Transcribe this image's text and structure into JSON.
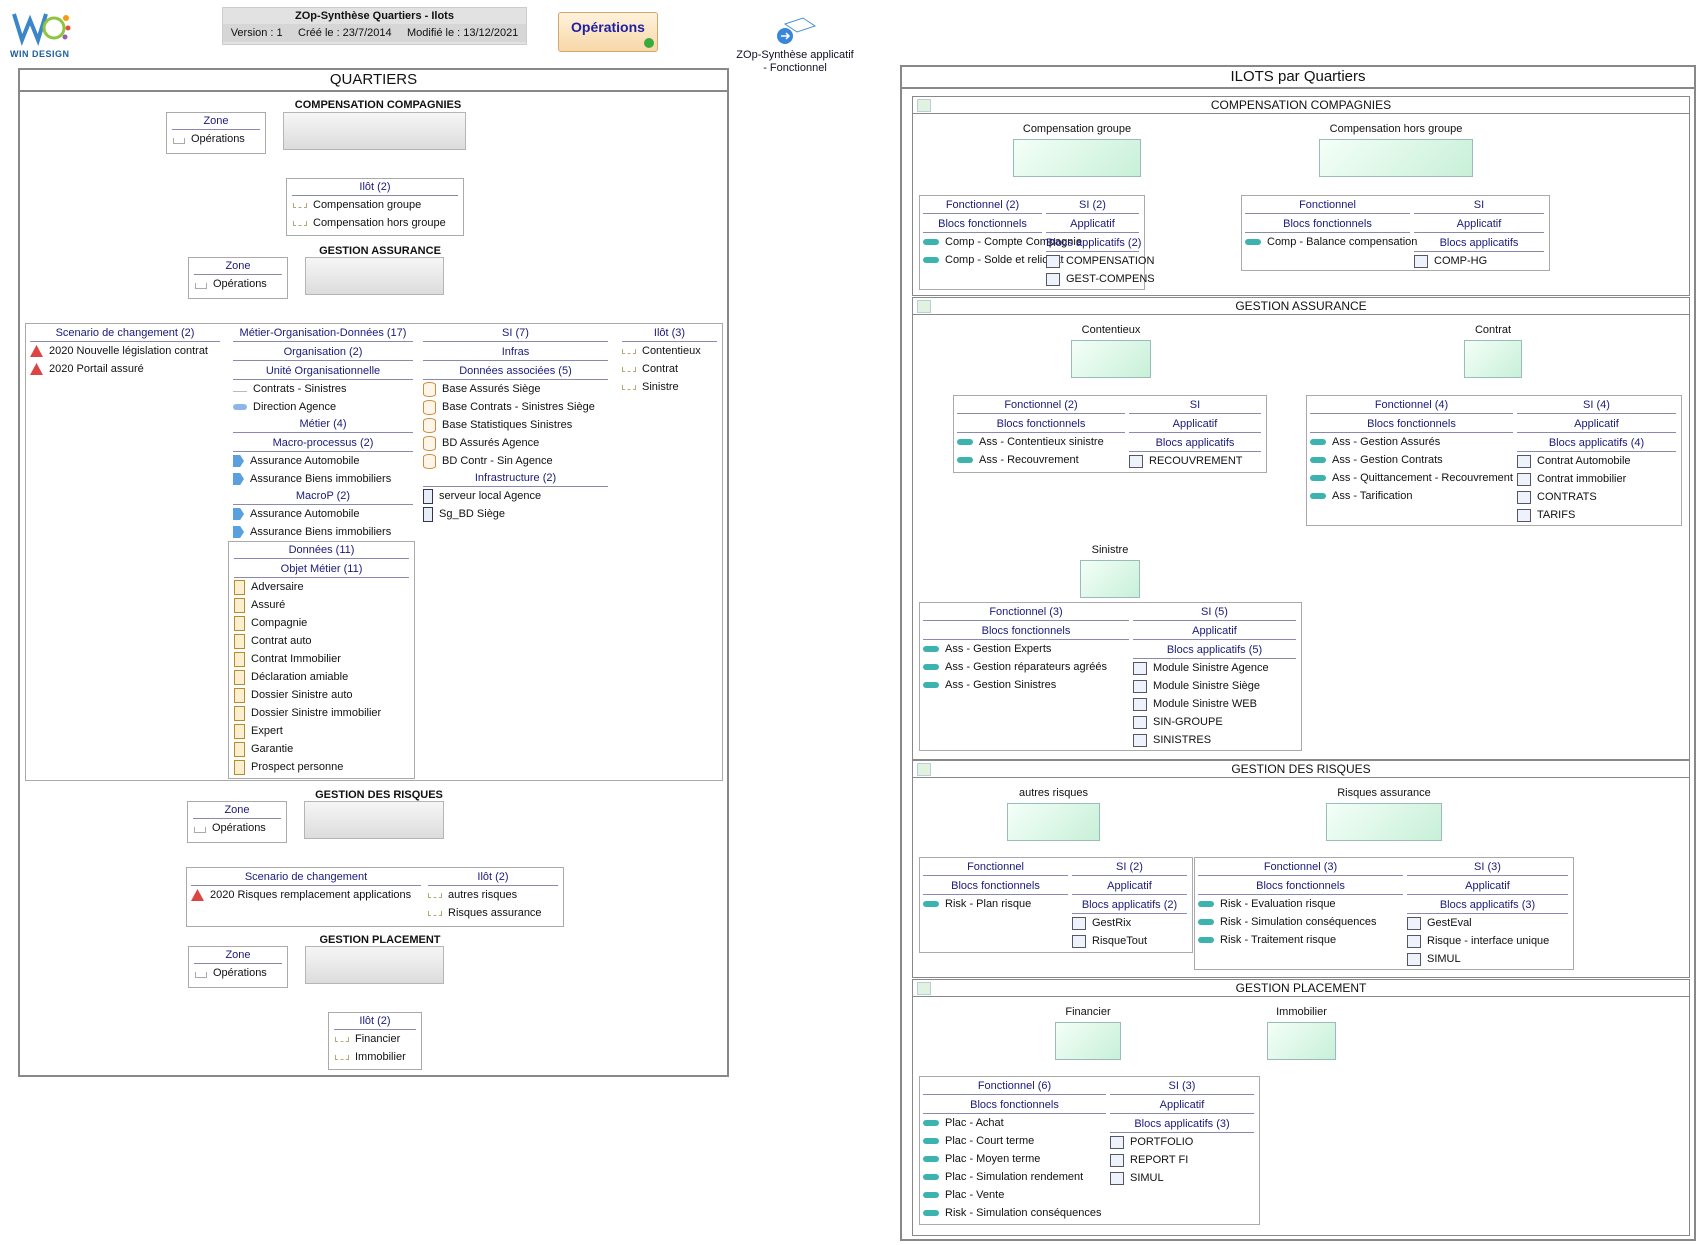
{
  "header": {
    "logo_text": "WIN DESIGN",
    "title": "ZOp-Synthèse Quartiers - Ilots",
    "version": "Version : 1",
    "created": "Créé le : 23/7/2014",
    "modified": "Modifié le : 13/12/2021",
    "operations_button": "Opérations",
    "link_label_1": "ZOp-Synthèse applicatif",
    "link_label_2": "- Fonctionnel"
  },
  "left": {
    "title": "QUARTIERS",
    "comp": {
      "title": "COMPENSATION COMPAGNIES",
      "zone_header": "Zone",
      "zone_item": "Opérations"
    },
    "comp_ilot": {
      "header": "Ilôt (2)",
      "items": [
        "Compensation groupe",
        "Compensation hors groupe"
      ]
    },
    "assur": {
      "title": "GESTION ASSURANCE",
      "zone_header": "Zone",
      "zone_item": "Opérations"
    },
    "big": {
      "scen_header": "Scenario de changement (2)",
      "scen_items": [
        "2020 Nouvelle législation contrat",
        "2020 Portail assuré"
      ],
      "mod_header": "Métier-Organisation-Données (17)",
      "org_header": "Organisation (2)",
      "unit_header": "Unité Organisationnelle",
      "unit_items": [
        "Contrats - Sinistres",
        "Direction Agence"
      ],
      "metier_header": "Métier (4)",
      "macro_header": "Macro-processus (2)",
      "macro_items": [
        "Assurance Automobile",
        "Assurance Biens immobiliers"
      ],
      "macrop_header": "MacroP (2)",
      "macrop_items": [
        "Assurance Automobile",
        "Assurance Biens immobiliers"
      ],
      "donnees_header": "Données (11)",
      "objet_header": "Objet Métier (11)",
      "objet_items": [
        "Adversaire",
        "Assuré",
        "Compagnie",
        "Contrat auto",
        "Contrat Immobilier",
        "Déclaration amiable",
        "Dossier Sinistre auto",
        "Dossier Sinistre immobilier",
        "Expert",
        "Garantie",
        "Prospect personne"
      ],
      "si_header": "SI (7)",
      "infras_header": "Infras",
      "donassoc_header": "Données associées (5)",
      "donassoc_items": [
        "Base Assurés Siège",
        "Base Contrats - Sinistres Siège",
        "Base Statistiques Sinistres",
        "BD Assurés Agence",
        "BD Contr - Sin Agence"
      ],
      "infra_header": "Infrastructure (2)",
      "infra_items": [
        "serveur local  Agence",
        "Sg_BD Siège"
      ],
      "ilot_header": "Ilôt (3)",
      "ilot_items": [
        "Contentieux",
        "Contrat",
        "Sinistre"
      ]
    },
    "risques": {
      "title": "GESTION DES RISQUES",
      "zone_header": "Zone",
      "zone_item": "Opérations",
      "scen_header": "Scenario de changement",
      "scen_items": [
        "2020 Risques remplacement applications"
      ],
      "ilot_header": "Ilôt (2)",
      "ilot_items": [
        "autres risques",
        "Risques assurance"
      ]
    },
    "placement": {
      "title": "GESTION PLACEMENT",
      "zone_header": "Zone",
      "zone_item": "Opérations",
      "ilot_header": "Ilôt (2)",
      "ilot_items": [
        "Financier",
        "Immobilier"
      ]
    }
  },
  "right": {
    "title": "ILOTS par Quartiers",
    "sections": [
      {
        "title": "COMPENSATION COMPAGNIES",
        "ilots": [
          "Compensation groupe",
          "Compensation hors groupe"
        ],
        "groups": [
          {
            "fonc": "Fonctionnel (2)",
            "blocs": [
              "Comp - Compte Compagnie",
              "Comp - Solde et reliquat"
            ],
            "si": "SI (2)",
            "apps_header": "Blocs applicatifs (2)",
            "apps": [
              "COMPENSATION",
              "GEST-COMPENS"
            ]
          },
          {
            "fonc": "Fonctionnel",
            "blocs": [
              "Comp - Balance compensation"
            ],
            "si": "SI",
            "apps_header": "Blocs applicatifs",
            "apps": [
              "COMP-HG"
            ]
          }
        ]
      },
      {
        "title": "GESTION ASSURANCE",
        "ilots": [
          "Contentieux",
          "Contrat",
          "Sinistre"
        ],
        "groups": [
          {
            "fonc": "Fonctionnel (2)",
            "blocs": [
              "Ass - Contentieux sinistre",
              "Ass - Recouvrement"
            ],
            "si": "SI",
            "apps_header": "Blocs applicatifs",
            "apps": [
              "RECOUVREMENT"
            ]
          },
          {
            "fonc": "Fonctionnel (4)",
            "blocs": [
              "Ass - Gestion Assurés",
              "Ass - Gestion Contrats",
              "Ass - Quittancement - Recouvrement",
              "Ass - Tarification"
            ],
            "si": "SI (4)",
            "apps_header": "Blocs applicatifs (4)",
            "apps": [
              "Contrat Automobile",
              "Contrat immobilier",
              "CONTRATS",
              "TARIFS"
            ]
          },
          {
            "fonc": "Fonctionnel (3)",
            "blocs": [
              "Ass - Gestion Experts",
              "Ass - Gestion réparateurs agréés",
              "Ass - Gestion Sinistres"
            ],
            "si": "SI (5)",
            "apps_header": "Blocs applicatifs (5)",
            "apps": [
              "Module Sinistre Agence",
              "Module Sinistre Siège",
              "Module Sinistre WEB",
              "SIN-GROUPE",
              "SINISTRES"
            ]
          }
        ]
      },
      {
        "title": "GESTION DES RISQUES",
        "ilots": [
          "autres risques",
          "Risques assurance"
        ],
        "groups": [
          {
            "fonc": "Fonctionnel",
            "blocs": [
              "Risk - Plan risque"
            ],
            "si": "SI (2)",
            "apps_header": "Blocs applicatifs (2)",
            "apps": [
              "GestRix",
              "RisqueTout"
            ]
          },
          {
            "fonc": "Fonctionnel (3)",
            "blocs": [
              "Risk - Evaluation risque",
              "Risk - Simulation conséquences",
              "Risk - Traitement risque"
            ],
            "si": "SI (3)",
            "apps_header": "Blocs applicatifs (3)",
            "apps": [
              "GestEval",
              "Risque - interface unique",
              "SIMUL"
            ]
          }
        ]
      },
      {
        "title": "GESTION PLACEMENT",
        "ilots": [
          "Financier",
          "Immobilier"
        ],
        "groups": [
          {
            "fonc": "Fonctionnel (6)",
            "blocs": [
              "Plac - Achat",
              "Plac - Court terme",
              "Plac - Moyen terme",
              "Plac - Simulation rendement",
              "Plac - Vente",
              "Risk - Simulation conséquences"
            ],
            "si": "SI (3)",
            "apps_header": "Blocs applicatifs (3)",
            "apps": [
              "PORTFOLIO",
              "REPORT FI",
              "SIMUL"
            ]
          }
        ]
      }
    ],
    "blocs_label": "Blocs fonctionnels",
    "applicatif_label": "Applicatif"
  }
}
